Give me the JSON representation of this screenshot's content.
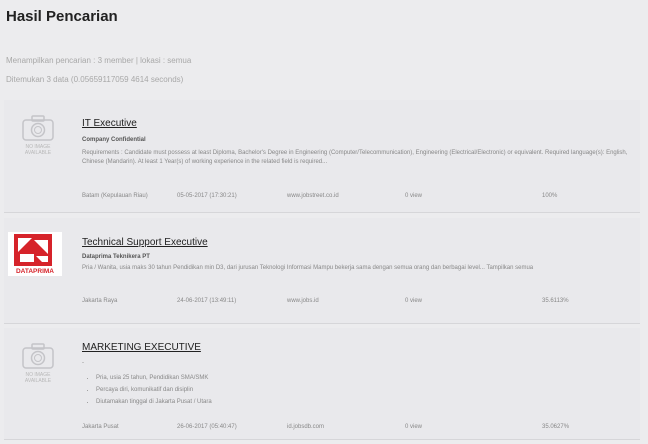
{
  "page": {
    "title": "Hasil Pencarian",
    "summary": "Menampilkan pencarian : 3 member | lokasi : semua",
    "timing": "Ditemukan 3 data (0.05659117059 4614 seconds)"
  },
  "no_image_caption": "NO IMAGE AVAILABLE",
  "results": [
    {
      "title": "IT Executive",
      "company": "Company Confidential",
      "description": "Requirements : Candidate must possess at least Diploma, Bachelor's Degree in Engineering (Computer/Telecommunication), Engineering (Electrical/Electronic) or equivalent. Required language(s): English, Chinese (Mandarin). At least 1 Year(s) of working experience in the related field is required...",
      "location": "Batam (Kepulauan Riau)",
      "date": "05-05-2017 (17:30:21)",
      "source": "www.jobstreet.co.id",
      "views": "0 view",
      "score": "100%"
    },
    {
      "title": "Technical Support Executive",
      "company": "Dataprima Teknikera PT",
      "description": "Pria / Wanita, usia maks 30 tahun Pendidikan min D3, dari jurusan Teknologi Informasi Mampu bekerja sama dengan semua orang dan berbagai level... Tampilkan semua",
      "location": "Jakarta Raya",
      "date": "24-06-2017 (13:49:11)",
      "source": "www.jobs.id",
      "views": "0 view",
      "score": "35.6113%",
      "logo_text": "DATAPRIMA",
      "logo_color": "#d6232a"
    },
    {
      "title": "MARKETING EXECUTIVE",
      "company": "",
      "dash": "-",
      "bullets": [
        "Pria, usia 25 tahun, Pendidikan SMA/SMK",
        "Percaya diri, komunikatif dan disiplin",
        "Diutamakan tinggal di Jakarta Pusat / Utara"
      ],
      "location": "Jakarta Pusat",
      "date": "26-06-2017 (05:40:47)",
      "source": "id.jobsdb.com",
      "views": "0 view",
      "score": "35.0627%"
    }
  ]
}
